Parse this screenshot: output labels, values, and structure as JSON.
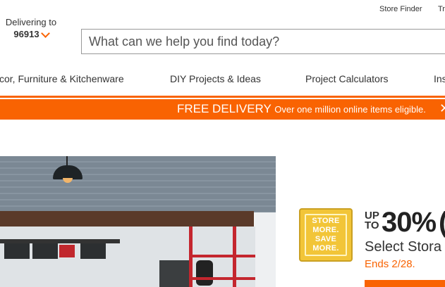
{
  "header": {
    "store_finder": "Store Finder",
    "truck_link": "Tr",
    "delivering_label": "Delivering to",
    "zip": "96913",
    "search_placeholder": "What can we help you find today?"
  },
  "nav": {
    "items": [
      {
        "label": "cor, Furniture & Kitchenware"
      },
      {
        "label": "DIY Projects & Ideas"
      },
      {
        "label": "Project Calculators"
      },
      {
        "label": "Ins"
      }
    ]
  },
  "promo": {
    "headline": "FREE DELIVERY",
    "subline": "Over one million online items eligible.",
    "close_icon": "close-icon"
  },
  "hero": {
    "image": "garage-storage-scene"
  },
  "offer": {
    "badge_lines": [
      "STORE",
      "MORE.",
      "SAVE",
      "MORE."
    ],
    "up": "UP",
    "to": "TO",
    "percent": "30%",
    "select": "Select Stora",
    "ends": "Ends 2/28."
  },
  "colors": {
    "accent": "#f96302",
    "badge": "#f2c538"
  }
}
